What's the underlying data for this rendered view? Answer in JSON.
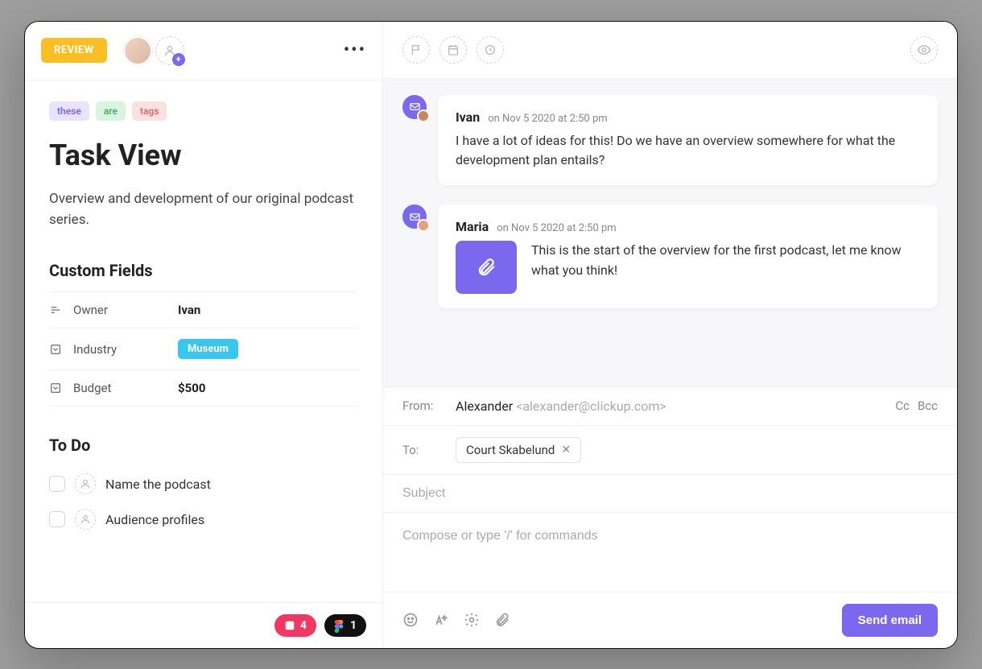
{
  "status": "REVIEW",
  "tags": [
    "these",
    "are",
    "tags"
  ],
  "title": "Task View",
  "description": "Overview and development of our original podcast series.",
  "custom_fields_heading": "Custom Fields",
  "fields": {
    "owner": {
      "label": "Owner",
      "value": "Ivan"
    },
    "industry": {
      "label": "Industry",
      "value": "Museum"
    },
    "budget": {
      "label": "Budget",
      "value": "$500"
    }
  },
  "todo_heading": "To Do",
  "todos": [
    {
      "label": "Name the podcast"
    },
    {
      "label": "Audience profiles"
    }
  ],
  "footer_badges": {
    "invision": "4",
    "figma": "1"
  },
  "messages": [
    {
      "author": "Ivan",
      "time": "on Nov 5 2020 at 2:50 pm",
      "body": "I have a lot of ideas for this! Do we have an overview somewhere for what the development plan entails?",
      "avatar_bg": "#c58b5b"
    },
    {
      "author": "Maria",
      "time": "on Nov 5 2020 at 2:50 pm",
      "body": "This is the start of the overview for the first podcast, let me know what you think!",
      "has_attachment": true,
      "avatar_bg": "#e7a07e"
    }
  ],
  "composer": {
    "from_label": "From:",
    "from_name": "Alexander",
    "from_email": "<alexander@clickup.com>",
    "cc": "Cc",
    "bcc": "Bcc",
    "to_label": "To:",
    "recipient": "Court Skabelund",
    "subject_placeholder": "Subject",
    "body_placeholder": "Compose or type '/' for commands",
    "send_label": "Send email"
  }
}
